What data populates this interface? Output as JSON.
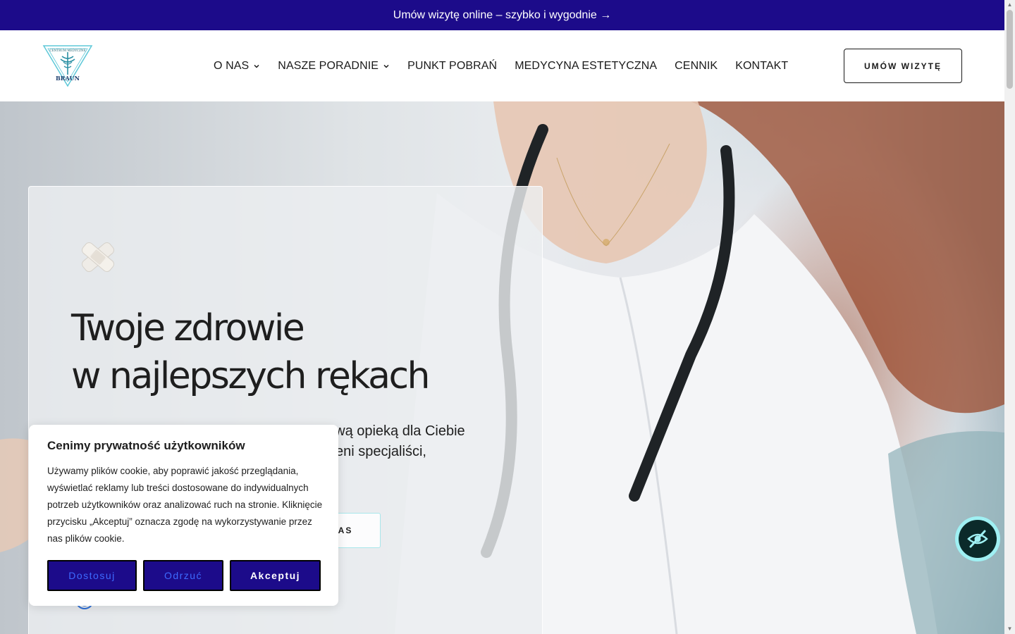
{
  "topbar": {
    "text": "Umów wizytę online – szybko i wygodnie →"
  },
  "header": {
    "logo": {
      "line1": "CENTRUM MEDYCZNE",
      "line2": "BRAUN"
    },
    "nav": [
      {
        "label": "O NAS",
        "has_dropdown": true
      },
      {
        "label": "NASZE PORADNIE",
        "has_dropdown": true
      },
      {
        "label": "PUNKT POBRAŃ",
        "has_dropdown": false
      },
      {
        "label": "MEDYCYNA ESTETYCZNA",
        "has_dropdown": false
      },
      {
        "label": "CENNIK",
        "has_dropdown": false
      },
      {
        "label": "KONTAKT",
        "has_dropdown": false
      }
    ],
    "cta_label": "UMÓW WIZYTĘ"
  },
  "hero": {
    "title_line1": "Twoje zdrowie",
    "title_line2": "w najlepszych rękach",
    "desc_line1": "sową opieką dla Ciebie",
    "desc_line2": "eni specjaliści,",
    "button_label": "AS"
  },
  "cookie": {
    "title": "Cenimy prywatność użytkowników",
    "text": "Używamy plików cookie, aby poprawić jakość przeglądania, wyświetlać reklamy lub treści dostosowane do indywidualnych potrzeb użytkowników oraz analizować ruch na stronie. Kliknięcie przycisku „Akceptuj” oznacza zgodę na wykorzystywanie przez nas plików cookie.",
    "customize_label": "Dostosuj",
    "reject_label": "Odrzuć",
    "accept_label": "Akceptuj"
  },
  "icons": {
    "a11y": "eye-slash-icon",
    "bandage": "bandage-icon",
    "ring": "ring-icon"
  },
  "colors": {
    "brand_primary": "#1c0b8a",
    "accent_cyan": "#9ff0f3",
    "text_dark": "#1e1e1e",
    "cookie_secondary_text": "#3d6bff"
  }
}
